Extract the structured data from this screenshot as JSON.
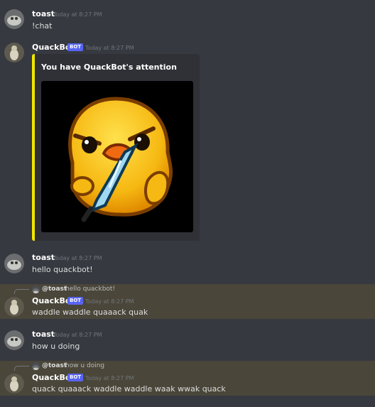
{
  "messages": [
    {
      "username": "toast",
      "timestamp": "Today at 8:27 PM",
      "text": "!chat"
    },
    {
      "username": "QuackBot",
      "badge": "BOT",
      "timestamp": "Today at 8:27 PM",
      "embed": {
        "title": "You have QuackBot's attention",
        "accent_color": "#f0e600",
        "image": "angry-duck-with-knife"
      }
    },
    {
      "username": "toast",
      "timestamp": "Today at 8:27 PM",
      "text": "hello quackbot!"
    },
    {
      "reply": {
        "mention": "@toast",
        "text": "hello quackbot!"
      },
      "username": "QuackBot",
      "badge": "BOT",
      "timestamp": "Today at 8:27 PM",
      "text": "waddle waddle quaaack quak"
    },
    {
      "username": "toast",
      "timestamp": "Today at 8:27 PM",
      "text": "how u doing"
    },
    {
      "reply": {
        "mention": "@toast",
        "text": "how u doing"
      },
      "username": "QuackBot",
      "badge": "BOT",
      "timestamp": "Today at 8:27 PM",
      "text": "quack quaaack waddle waddle waak wwak quack"
    }
  ],
  "colors": {
    "background": "#36393f",
    "highlight": "#4a4639",
    "bot_badge": "#5865f2",
    "embed_bg": "#2f3136"
  }
}
